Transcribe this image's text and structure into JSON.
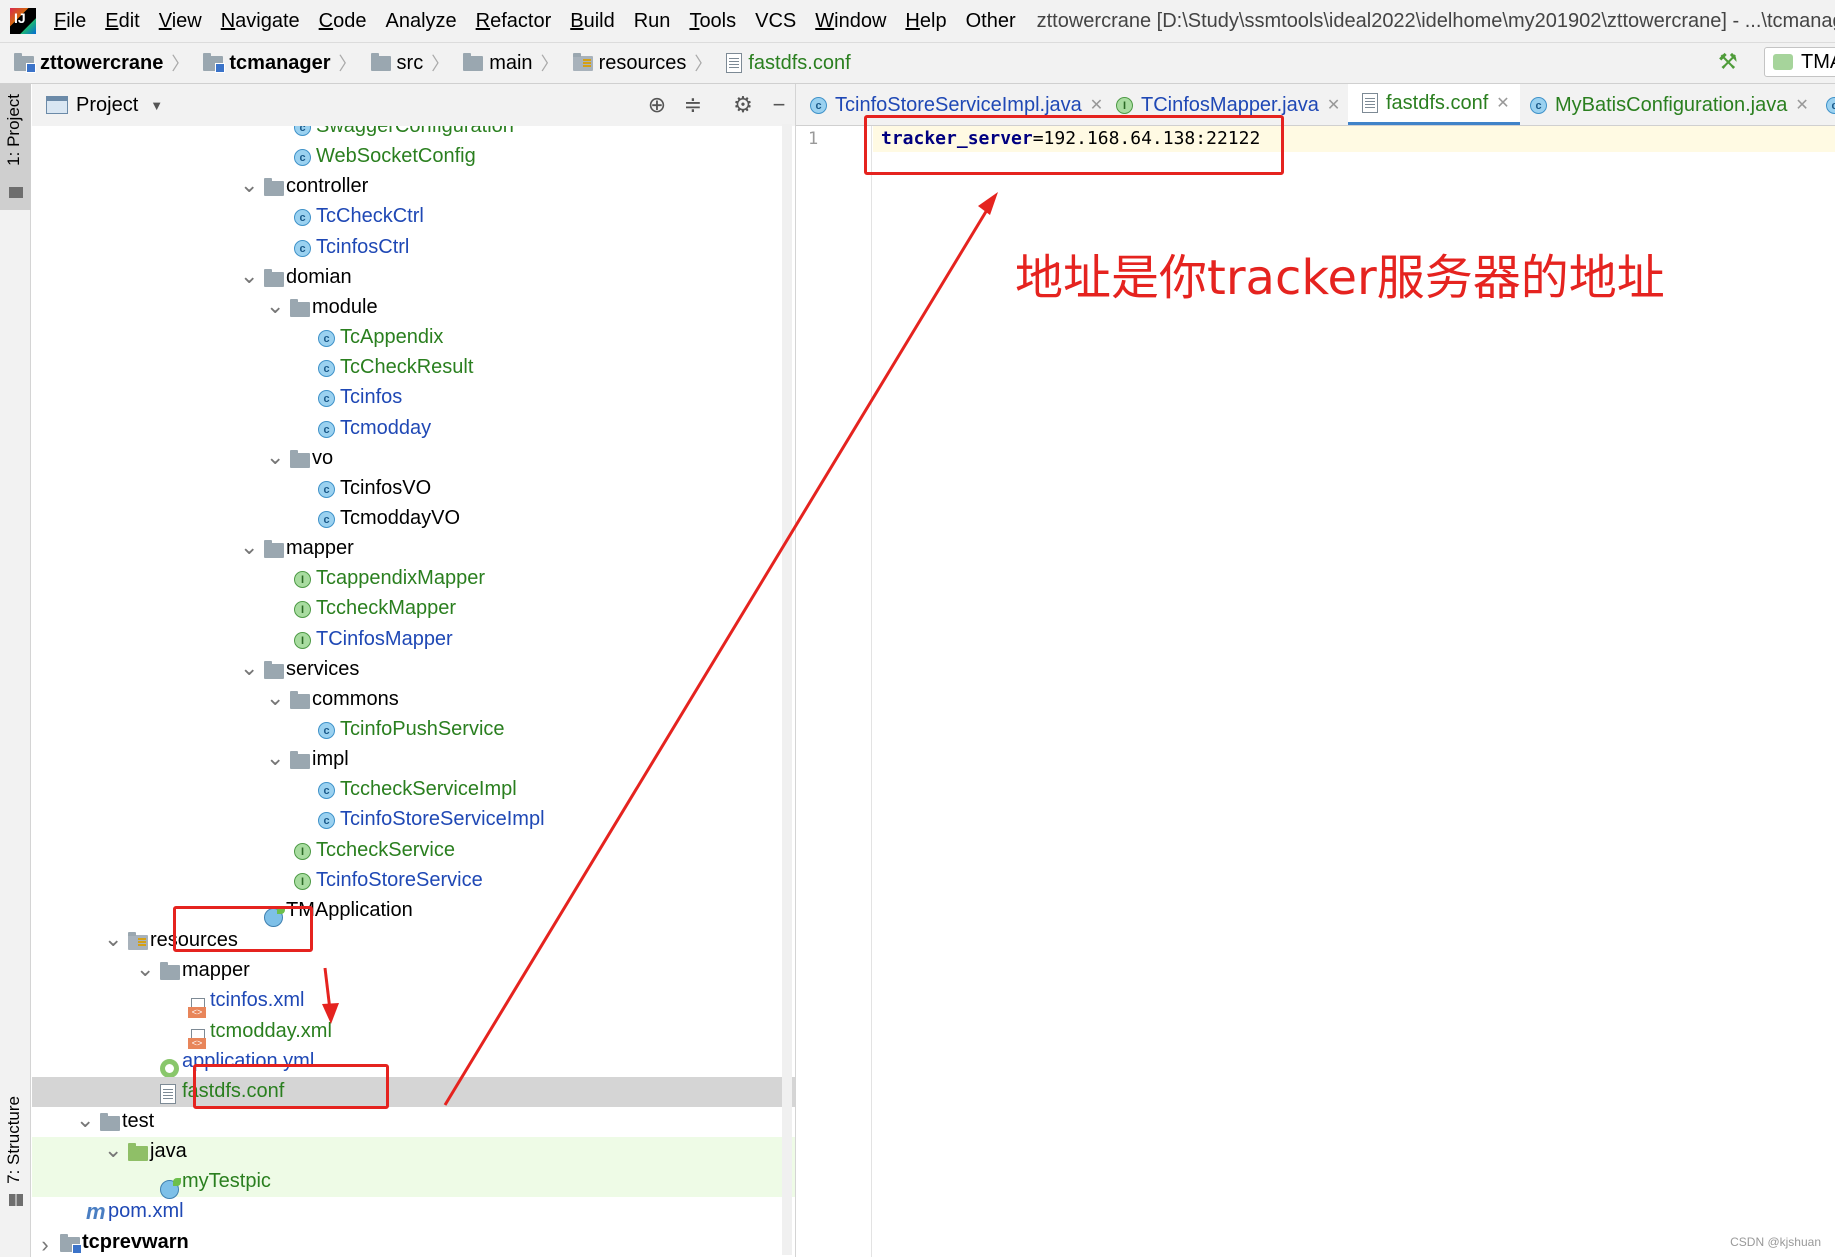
{
  "menu": {
    "items": [
      {
        "mn": "F",
        "rest": "ile"
      },
      {
        "mn": "E",
        "rest": "dit"
      },
      {
        "mn": "V",
        "rest": "iew"
      },
      {
        "mn": "N",
        "rest": "avigate"
      },
      {
        "mn": "C",
        "rest": "ode"
      },
      {
        "mn": "",
        "rest": "Analyze"
      },
      {
        "mn": "R",
        "rest": "efactor"
      },
      {
        "mn": "B",
        "rest": "uild"
      },
      {
        "mn": "",
        "rest": "Run"
      },
      {
        "mn": "T",
        "rest": "ools"
      },
      {
        "mn": "",
        "rest": "VCS"
      },
      {
        "mn": "W",
        "rest": "indow"
      },
      {
        "mn": "H",
        "rest": "elp"
      },
      {
        "mn": "",
        "rest": "Other"
      }
    ],
    "window_title": "zttowercrane [D:\\Study\\ssmtools\\ideal2022\\idelhome\\my201902\\zttowercrane] - ...\\tcmanager\\src"
  },
  "breadcrumb": {
    "items": [
      "zttowercrane",
      "tcmanager",
      "src",
      "main",
      "resources",
      "fastdfs.conf"
    ],
    "run_config": "TMA"
  },
  "left_stripe": {
    "project": "1: Project",
    "structure": "7: Structure"
  },
  "project_panel": {
    "title": "Project",
    "tree": [
      {
        "label": "SwaggerConfiguration",
        "icon": "class",
        "color": "green"
      },
      {
        "label": "WebSocketConfig",
        "icon": "class",
        "color": "green"
      },
      {
        "label": "controller",
        "icon": "folder",
        "color": "black",
        "expanded": true
      },
      {
        "label": "TcCheckCtrl",
        "icon": "class",
        "color": "blue"
      },
      {
        "label": "TcinfosCtrl",
        "icon": "class",
        "color": "blue"
      },
      {
        "label": "domian",
        "icon": "folder",
        "color": "black",
        "expanded": true
      },
      {
        "label": "module",
        "icon": "folder",
        "color": "black",
        "expanded": true
      },
      {
        "label": "TcAppendix",
        "icon": "class",
        "color": "green"
      },
      {
        "label": "TcCheckResult",
        "icon": "class",
        "color": "green"
      },
      {
        "label": "Tcinfos",
        "icon": "class",
        "color": "blue"
      },
      {
        "label": "Tcmodday",
        "icon": "class",
        "color": "blue"
      },
      {
        "label": "vo",
        "icon": "folder",
        "color": "black",
        "expanded": true
      },
      {
        "label": "TcinfosVO",
        "icon": "class",
        "color": "black"
      },
      {
        "label": "TcmoddayVO",
        "icon": "class",
        "color": "black"
      },
      {
        "label": "mapper",
        "icon": "folder",
        "color": "black",
        "expanded": true
      },
      {
        "label": "TcappendixMapper",
        "icon": "interface",
        "color": "green"
      },
      {
        "label": "TccheckMapper",
        "icon": "interface",
        "color": "green"
      },
      {
        "label": "TCinfosMapper",
        "icon": "interface",
        "color": "blue"
      },
      {
        "label": "services",
        "icon": "folder",
        "color": "black",
        "expanded": true
      },
      {
        "label": "commons",
        "icon": "folder",
        "color": "black",
        "expanded": true
      },
      {
        "label": "TcinfoPushService",
        "icon": "class",
        "color": "green"
      },
      {
        "label": "impl",
        "icon": "folder",
        "color": "black",
        "expanded": true
      },
      {
        "label": "TccheckServiceImpl",
        "icon": "class",
        "color": "green"
      },
      {
        "label": "TcinfoStoreServiceImpl",
        "icon": "class",
        "color": "blue"
      },
      {
        "label": "TccheckService",
        "icon": "interface",
        "color": "green"
      },
      {
        "label": "TcinfoStoreService",
        "icon": "interface",
        "color": "blue"
      },
      {
        "label": "TMApplication",
        "icon": "spring",
        "color": "black"
      },
      {
        "label": "resources",
        "icon": "resources-folder",
        "color": "black",
        "expanded": true
      },
      {
        "label": "mapper",
        "icon": "folder",
        "color": "black",
        "expanded": true
      },
      {
        "label": "tcinfos.xml",
        "icon": "xml",
        "color": "blue"
      },
      {
        "label": "tcmodday.xml",
        "icon": "xml",
        "color": "green"
      },
      {
        "label": "application.yml",
        "icon": "yml",
        "color": "blue"
      },
      {
        "label": "fastdfs.conf",
        "icon": "file",
        "color": "green",
        "selected": true
      },
      {
        "label": "test",
        "icon": "folder",
        "color": "black",
        "expanded": true
      },
      {
        "label": "java",
        "icon": "test-folder",
        "color": "black",
        "expanded": true
      },
      {
        "label": "myTestpic",
        "icon": "spring",
        "color": "green"
      },
      {
        "label": "pom.xml",
        "icon": "maven",
        "color": "blue"
      },
      {
        "label": "tcprevwarn",
        "icon": "module-folder",
        "color": "black",
        "bold": true,
        "expanded": false
      }
    ]
  },
  "editor": {
    "tabs": [
      {
        "label": "TcinfoStoreServiceImpl.java",
        "icon": "class",
        "color": "blue"
      },
      {
        "label": "TCinfosMapper.java",
        "icon": "interface",
        "color": "blue"
      },
      {
        "label": "fastdfs.conf",
        "icon": "file",
        "color": "green",
        "active": true
      },
      {
        "label": "MyBatisConfiguration.java",
        "icon": "class",
        "color": "green"
      }
    ],
    "line_number": "1",
    "code_key": "tracker_server",
    "code_value": "=192.168.64.138:22122"
  },
  "annotation": {
    "text": "地址是你tracker服务器的地址",
    "color": "#e5231f"
  },
  "watermark": "CSDN @kjshuan"
}
